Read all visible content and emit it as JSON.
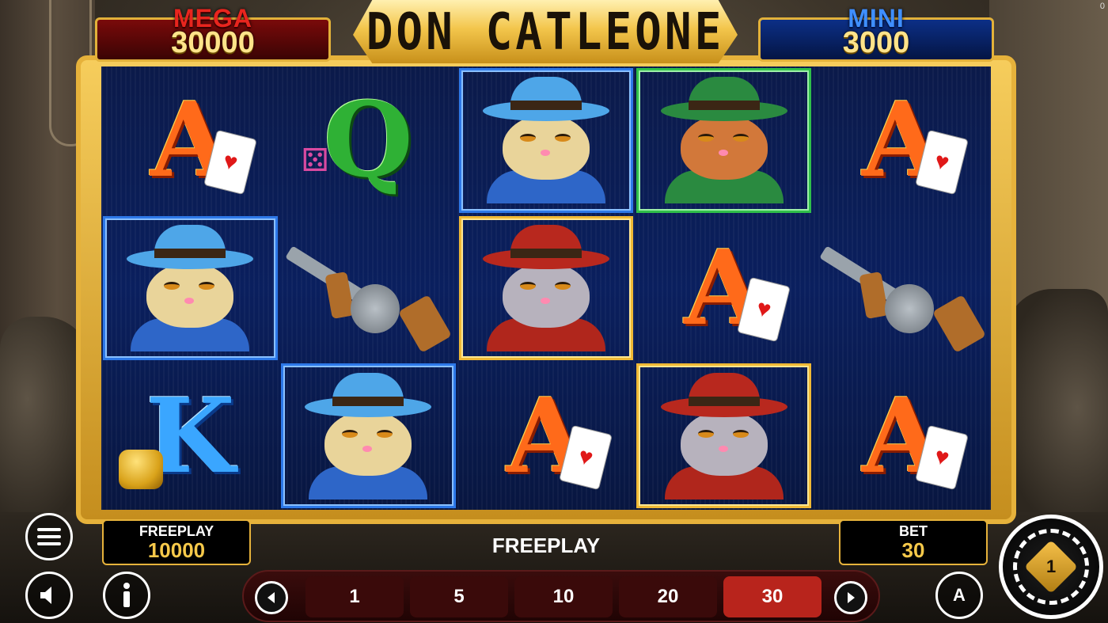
{
  "jackpots": {
    "mega": {
      "label": "MEGA",
      "value": "30000"
    },
    "mini": {
      "label": "MINI",
      "value": "3000"
    }
  },
  "title": "DON CATLEONE",
  "corner_counter": "0",
  "reels": [
    [
      "A",
      "blue-cat",
      "K"
    ],
    [
      "Q",
      "tommy-gun",
      "blue-cat"
    ],
    [
      "blue-cat",
      "red-cat",
      "A"
    ],
    [
      "green-cat",
      "A",
      "red-cat"
    ],
    [
      "A",
      "tommy-gun",
      "A"
    ]
  ],
  "freeplay_box": {
    "label": "FREEPLAY",
    "value": "10000"
  },
  "bet_box": {
    "label": "BET",
    "value": "30"
  },
  "status_text": "FREEPLAY",
  "bet_options": [
    "1",
    "5",
    "10",
    "20",
    "30"
  ],
  "selected_bet": "30",
  "auto_label": "A",
  "spin_logo": "1",
  "icons": {
    "menu": "menu-icon",
    "sound": "speaker-icon",
    "info": "info-icon",
    "prev": "chevron-left-icon",
    "next": "chevron-right-icon",
    "autoplay": "autoplay-icon",
    "spin": "spin-icon"
  },
  "colors": {
    "gold": "#e6b23b",
    "mega_red": "#e8251e",
    "mini_blue": "#3f8fff",
    "selected_bet": "#b8241c",
    "value_yellow": "#f6c94a"
  }
}
